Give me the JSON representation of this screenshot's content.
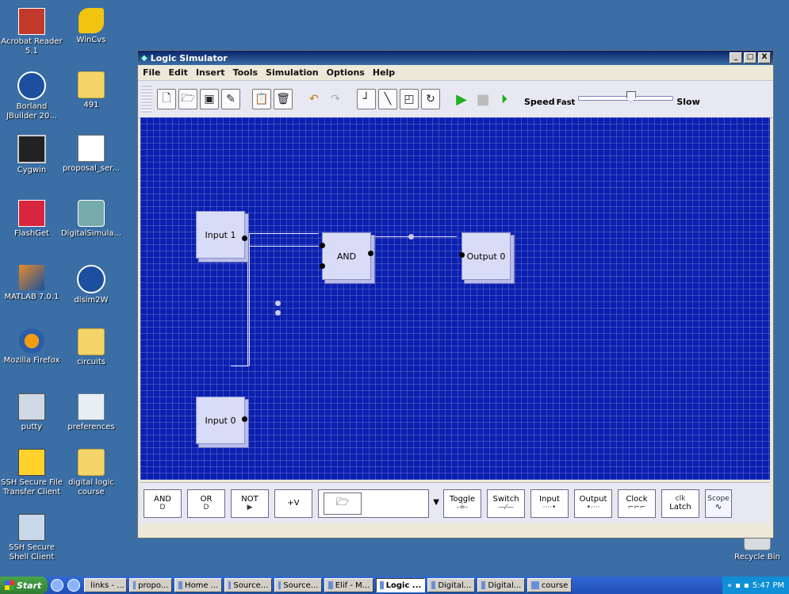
{
  "desktop": {
    "icons": [
      {
        "label": "Acrobat Reader 5.1",
        "icon": "pdf-icon"
      },
      {
        "label": "WinCvs",
        "icon": "cvs-icon"
      },
      {
        "label": "Borland JBuilder 20...",
        "icon": "jbuilder-icon"
      },
      {
        "label": "491",
        "icon": "folder-icon"
      },
      {
        "label": "Cygwin",
        "icon": "terminal-icon"
      },
      {
        "label": "proposal_ser...",
        "icon": "word-doc-icon"
      },
      {
        "label": "FlashGet",
        "icon": "flashget-icon"
      },
      {
        "label": "DigitalSimula...",
        "icon": "installer-icon"
      },
      {
        "label": "MATLAB 7.0.1",
        "icon": "matlab-icon"
      },
      {
        "label": "dlsim2W",
        "icon": "app-icon"
      },
      {
        "label": "Mozilla Firefox",
        "icon": "firefox-icon"
      },
      {
        "label": "circuits",
        "icon": "folder-icon"
      },
      {
        "label": "putty",
        "icon": "putty-icon"
      },
      {
        "label": "preferences",
        "icon": "preferences-icon"
      },
      {
        "label": "SSH Secure File Transfer Client",
        "icon": "ssh-file-icon"
      },
      {
        "label": "digital logic course",
        "icon": "zip-folder-icon"
      },
      {
        "label": "SSH Secure Shell Client",
        "icon": "ssh-shell-icon"
      }
    ],
    "recycle_bin": "Recycle Bin"
  },
  "window": {
    "title": "Logic Simulator",
    "controls": {
      "min": "_",
      "max": "□",
      "close": "X"
    }
  },
  "menu": [
    "File",
    "Edit",
    "Insert",
    "Tools",
    "Simulation",
    "Options",
    "Help"
  ],
  "toolbar": {
    "speed_label": "Speed",
    "fast_label": "Fast",
    "slow_label": "Slow",
    "speed_value": 0.55
  },
  "canvas": {
    "components": [
      {
        "id": "input1",
        "label": "Input 1"
      },
      {
        "id": "and",
        "label": "AND"
      },
      {
        "id": "output0",
        "label": "Output 0"
      },
      {
        "id": "input0",
        "label": "Input 0"
      }
    ]
  },
  "palette": {
    "items": [
      {
        "label": "AND",
        "sub": "D"
      },
      {
        "label": "OR",
        "sub": "D"
      },
      {
        "label": "NOT",
        "sub": "▶"
      },
      {
        "label": "+V",
        "sub": ""
      }
    ],
    "right_items": [
      {
        "label": "Toggle",
        "sub": "-≟-"
      },
      {
        "label": "Switch",
        "sub": "—⁄—"
      },
      {
        "label": "Input",
        "sub": "····•"
      },
      {
        "label": "Output",
        "sub": "•····"
      },
      {
        "label": "Clock",
        "sub": "⌐⌐⌐"
      },
      {
        "label": "Latch",
        "sub": "clk"
      },
      {
        "label": "Scope",
        "sub": "∿"
      }
    ]
  },
  "taskbar": {
    "start": "Start",
    "tasks": [
      "links - ...",
      "propo...",
      "Home ...",
      "Source...",
      "Source...",
      "Elif - M...",
      "Logic ...",
      "Digital...",
      "Digital...",
      "course"
    ],
    "active_index": 6,
    "clock": "5:47 PM"
  }
}
